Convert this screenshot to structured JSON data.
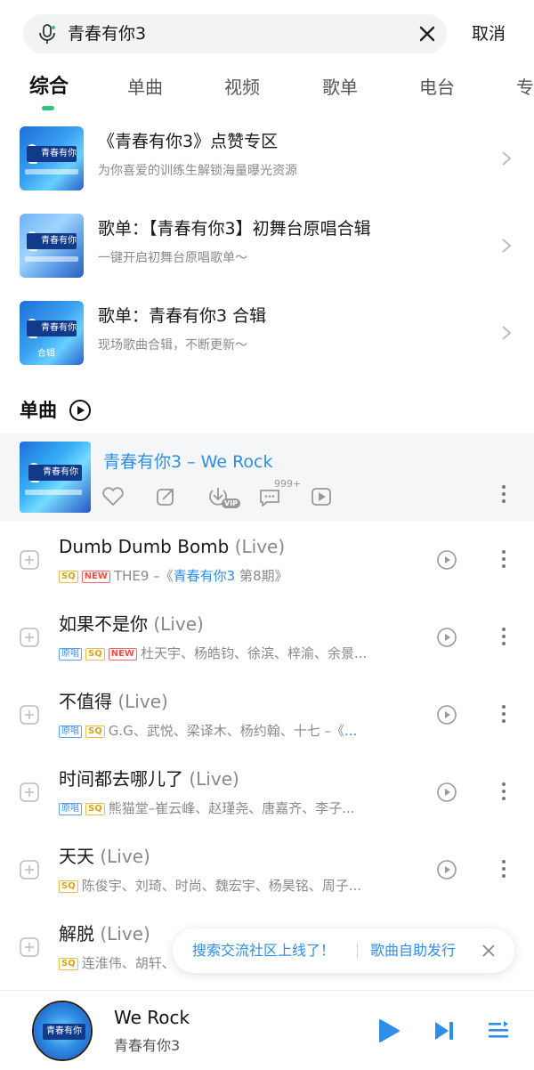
{
  "search": {
    "query": "青春有你3",
    "cancel_label": "取消"
  },
  "tabs": [
    {
      "label": "综合"
    },
    {
      "label": "单曲"
    },
    {
      "label": "视频"
    },
    {
      "label": "歌单"
    },
    {
      "label": "电台"
    },
    {
      "label": "专"
    }
  ],
  "promos": [
    {
      "title": "《青春有你3》点赞专区",
      "subtitle": "为你喜爱的训练生解锁海量曝光资源"
    },
    {
      "title": "歌单：【青春有你3】初舞台原唱合辑",
      "subtitle": "一键开启初舞台原唱歌单～"
    },
    {
      "title": "歌单：青春有你3 合辑",
      "subtitle": "现场歌曲合辑，不断更新～"
    }
  ],
  "thumb_texts": {
    "badge": "青春有你",
    "collection": "合辑"
  },
  "section": {
    "title": "单曲"
  },
  "featured": {
    "title": "青春有你3 – We Rock",
    "comment_count": "999+",
    "vip_label": "VIP"
  },
  "tag_labels": {
    "sq": "SQ",
    "new": "NEW",
    "orig": "原唱"
  },
  "songs": [
    {
      "name": "Dumb Dumb Bomb",
      "live": "(Live)",
      "meta_prefix": "THE9 –《",
      "meta_highlight": "青春有你3",
      "meta_suffix": " 第8期》"
    },
    {
      "name": "如果不是你",
      "live": "(Live)",
      "meta": "杜天宇、杨皓钧、徐滨、梓渝、余景..."
    },
    {
      "name": "不值得",
      "live": "(Live)",
      "meta_prefix": "G.G、武悦、梁译木、杨约翰、十七 –《",
      "meta_highlight": "...",
      "meta_suffix": ""
    },
    {
      "name": "时间都去哪儿了",
      "live": "(Live)",
      "meta": "熊猫堂–崔云峰、赵瑾尧、唐嘉齐、李子..."
    },
    {
      "name": "天天",
      "live": "(Live)",
      "meta": "陈俊宇、刘琦、时尚、魏宏宇、杨昊铭、周子..."
    },
    {
      "name": "解脱",
      "live": "(Live)",
      "meta": "连淮伟、胡轩、"
    }
  ],
  "toast": {
    "left": "搜索交流社区上线了！",
    "right": "歌曲自助发行"
  },
  "player": {
    "title": "We Rock",
    "artist": "青春有你3"
  },
  "colors": {
    "accent_green": "#31c27c",
    "link_blue": "#2f8ee6",
    "sq_gold": "#d8a21a",
    "new_red": "#e8524a"
  }
}
